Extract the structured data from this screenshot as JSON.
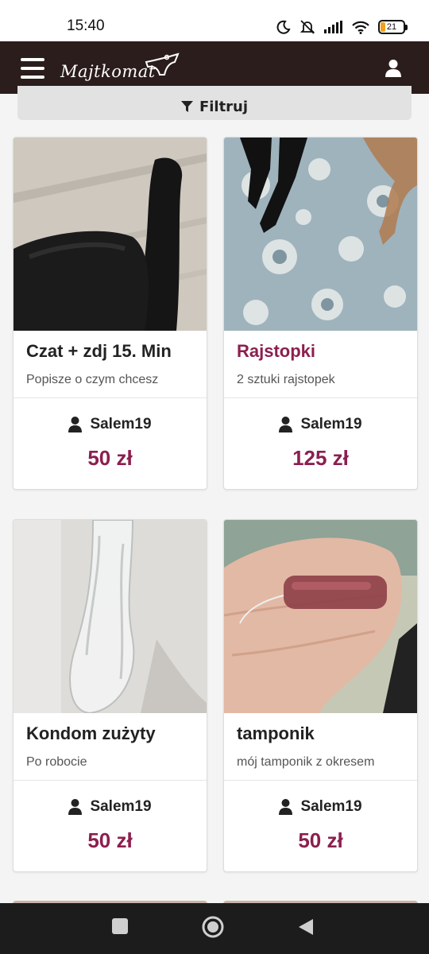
{
  "status_bar": {
    "time": "15:40",
    "battery": "21"
  },
  "header": {
    "logo_text": "Majtkomat"
  },
  "filter": {
    "label": "Filtruj"
  },
  "products": [
    {
      "title": "Czat + zdj 15. Min",
      "description": "Popisze o czym chcesz",
      "seller": "Salem19",
      "price": "50 zł"
    },
    {
      "title": "Rajstopki",
      "description": "2 sztuki rajstopek",
      "seller": "Salem19",
      "price": "125 zł"
    },
    {
      "title": "Kondom zużyty",
      "description": "Po robocie",
      "seller": "Salem19",
      "price": "50 zł"
    },
    {
      "title": "tamponik",
      "description": "mój tamponik z okresem",
      "seller": "Salem19",
      "price": "50 zł"
    }
  ],
  "colors": {
    "header_bg": "#2b1d1c",
    "accent": "#8c1f4f"
  },
  "icons": [
    "moon-icon",
    "mute-icon",
    "signal-icon",
    "wifi-icon",
    "battery-icon",
    "hamburger-menu-icon",
    "user-icon",
    "filter-icon",
    "person-icon",
    "square-nav-icon",
    "circle-nav-icon",
    "back-triangle-icon"
  ]
}
